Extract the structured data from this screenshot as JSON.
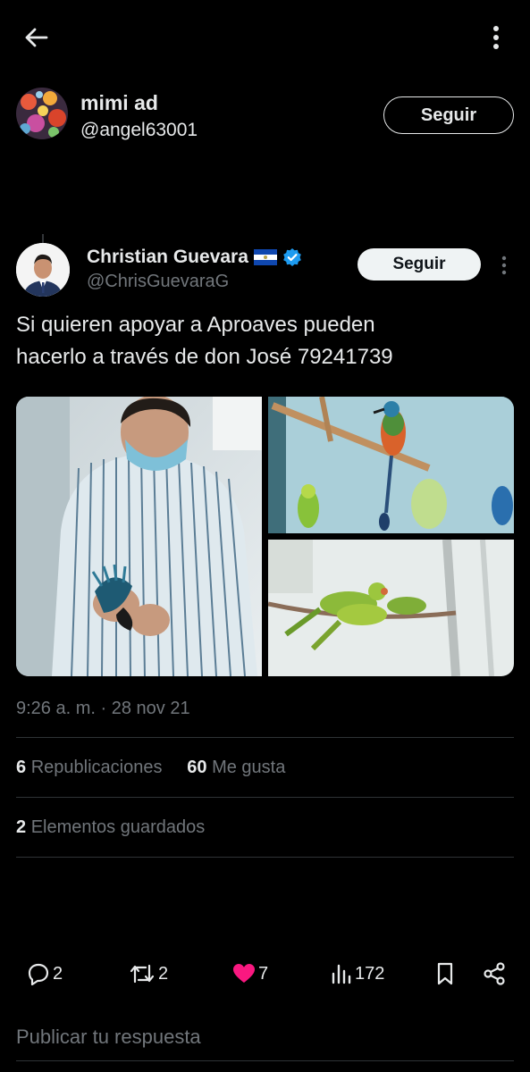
{
  "topbar": {
    "back_icon": "arrow-left-icon",
    "more_icon": "vertical-dots-icon"
  },
  "retweeter": {
    "name": "mimi ad",
    "handle": "@angel63001",
    "follow_label": "Seguir"
  },
  "author": {
    "name": "Christian Guevara",
    "flag": "🇸🇻",
    "verified_icon": "verified-badge-icon",
    "handle": "@ChrisGuevaraG",
    "follow_label": "Seguir"
  },
  "tweet": {
    "text_line1": "Si quieren apoyar a Aproaves pueden",
    "text_line2": "hacerlo a través de don José 79241739"
  },
  "media": [
    {
      "name": "man-holding-bird-photo"
    },
    {
      "name": "motmot-bird-on-perch-photo"
    },
    {
      "name": "parakeets-on-branch-photo"
    }
  ],
  "timestamp": "9:26 a. m. · 28 nov 21",
  "stats": {
    "reposts_count": "6",
    "reposts_label": "Republicaciones",
    "likes_count": "60",
    "likes_label": "Me gusta",
    "bookmarks_count": "2",
    "bookmarks_label": "Elementos guardados"
  },
  "actions": {
    "replies": "2",
    "retweets": "2",
    "likes": "7",
    "views": "172"
  },
  "colors": {
    "like_pink": "#f91880",
    "verified_blue": "#1d9bf0",
    "muted": "#71767b"
  },
  "reply_placeholder": "Publicar tu respuesta"
}
